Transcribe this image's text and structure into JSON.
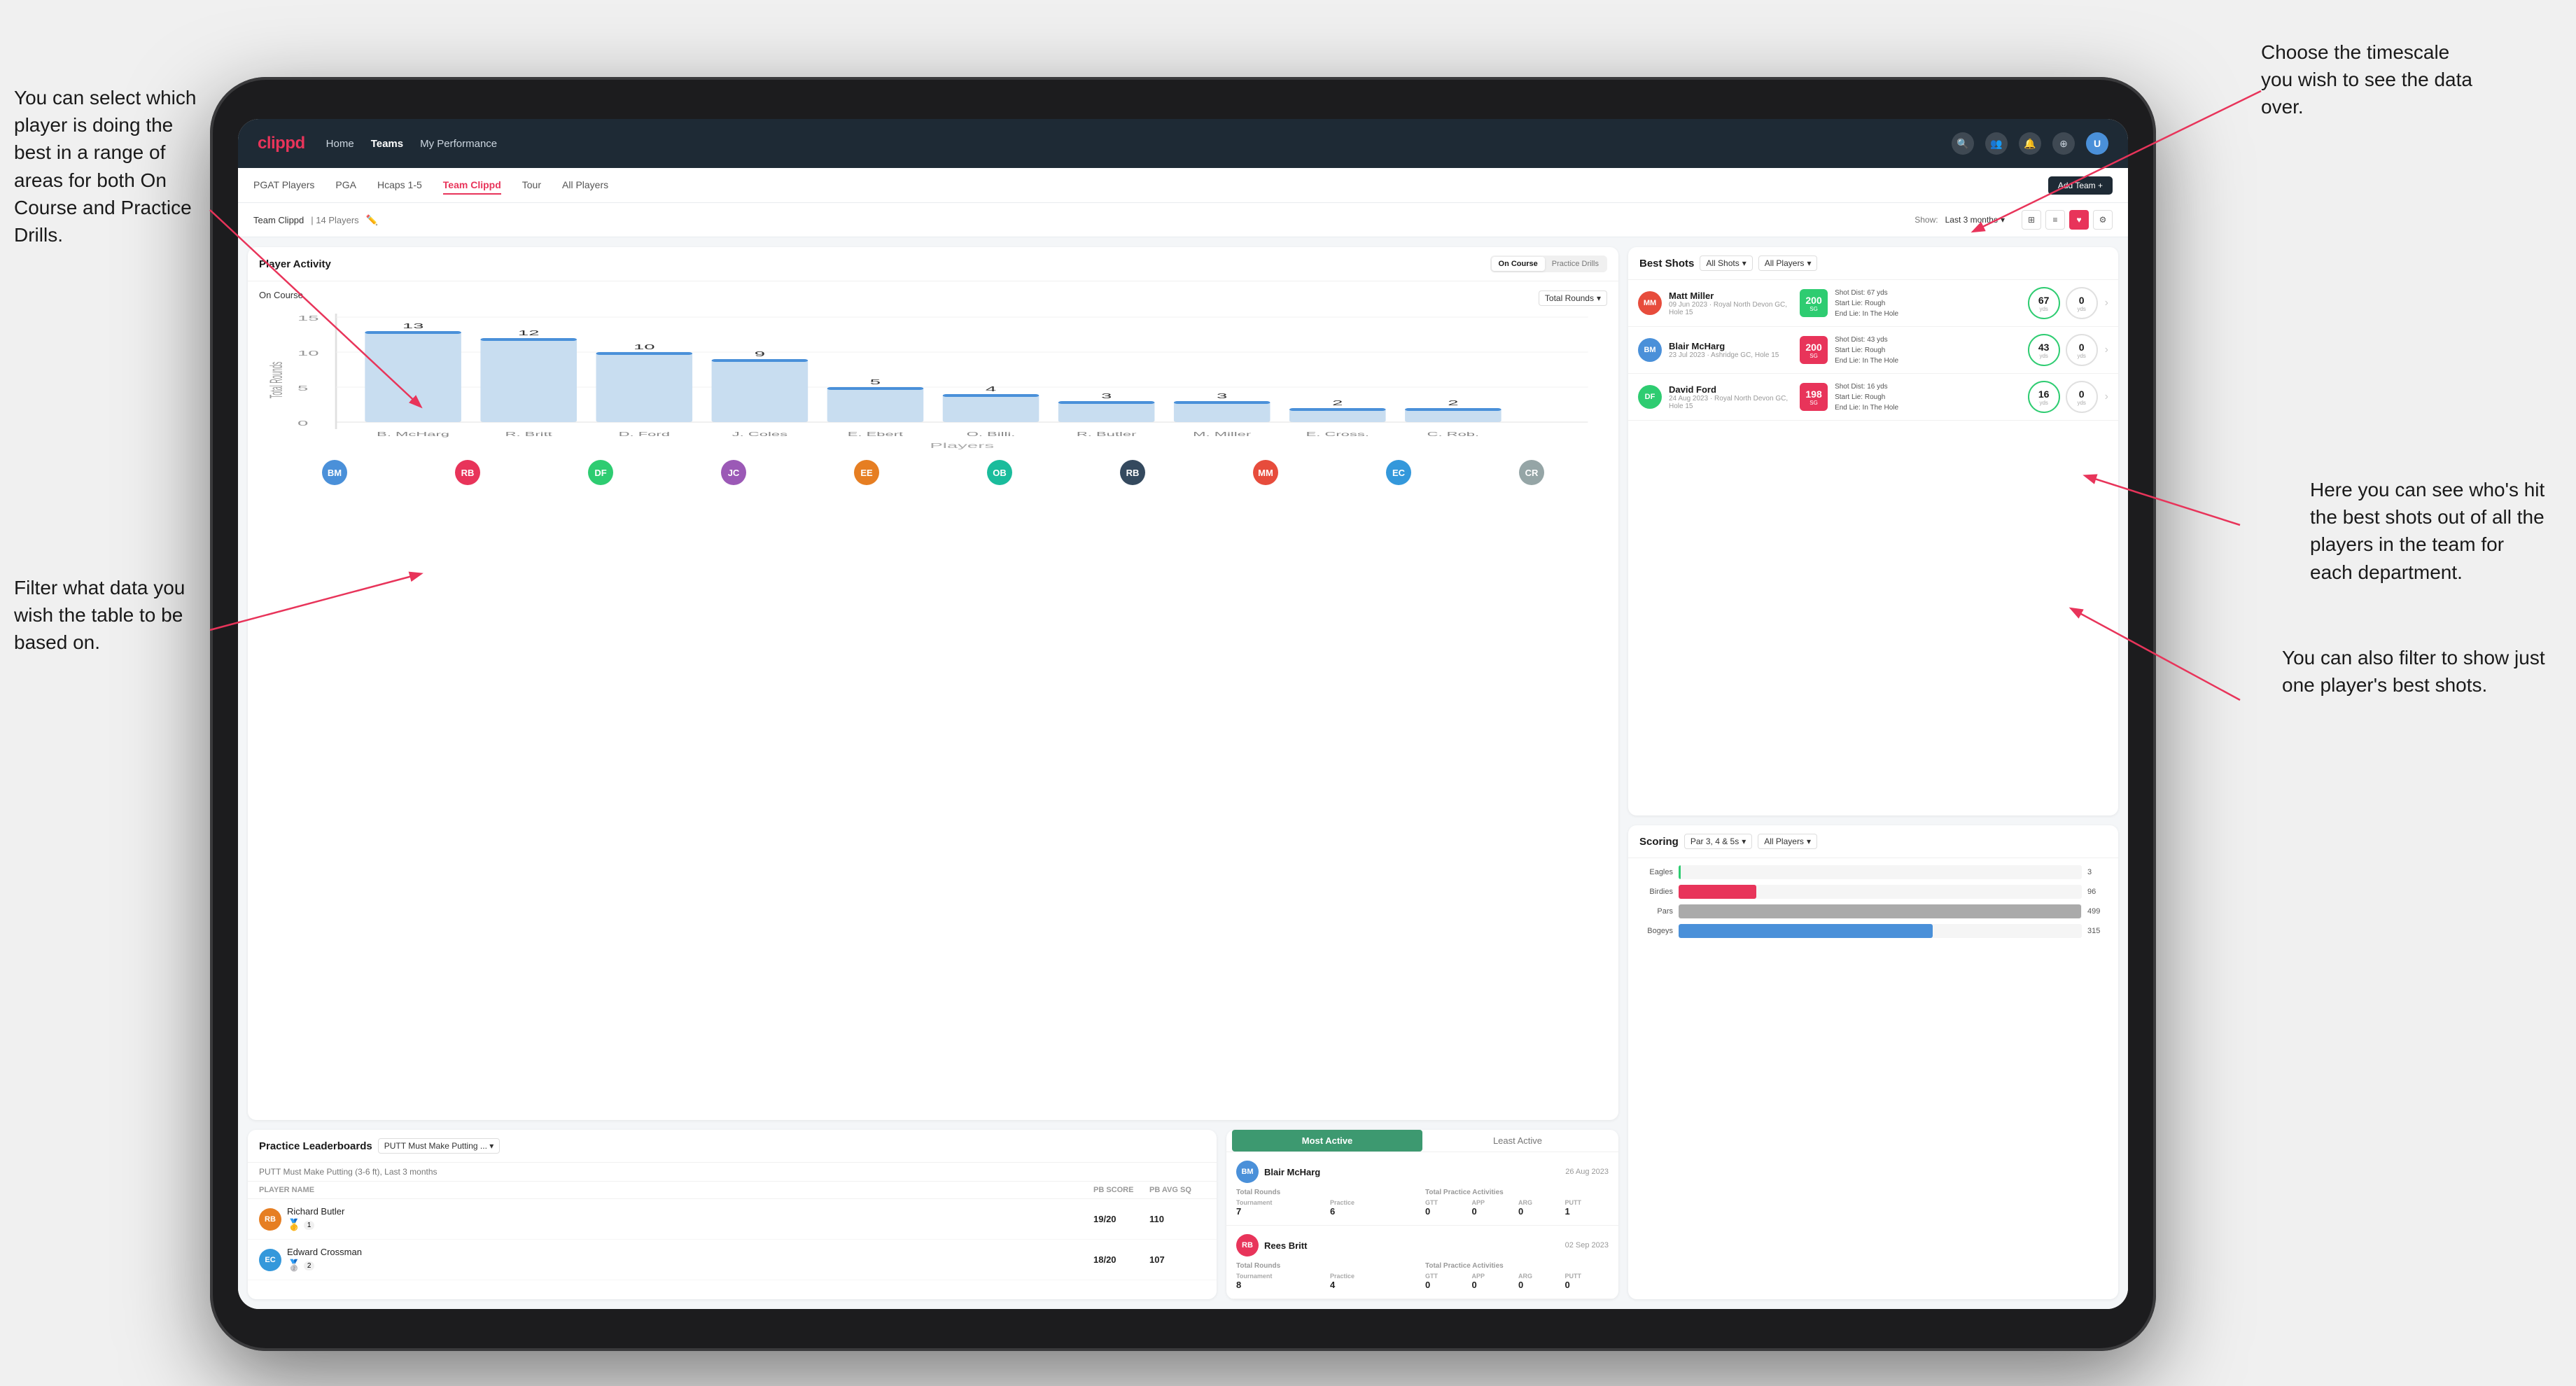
{
  "annotations": {
    "top_right": "Choose the timescale you wish to see the data over.",
    "left_top": "You can select which player is doing the best in a range of areas for both On Course and Practice Drills.",
    "left_bottom": "Filter what data you wish the table to be based on.",
    "right_middle": "Here you can see who's hit the best shots out of all the players in the team for each department.",
    "right_bottom": "You can also filter to show just one player's best shots."
  },
  "nav": {
    "logo": "clippd",
    "links": [
      "Home",
      "Teams",
      "My Performance"
    ],
    "active_link": "Teams"
  },
  "sub_tabs": [
    "PGAT Players",
    "PGA",
    "Hcaps 1-5",
    "Team Clippd",
    "Tour",
    "All Players"
  ],
  "active_tab": "Team Clippd",
  "add_team_btn": "Add Team +",
  "team_header": {
    "name": "Team Clippd",
    "count": "14 Players",
    "show_label": "Show:",
    "show_value": "Last 3 months",
    "view_options": [
      "grid",
      "table",
      "heart",
      "settings"
    ]
  },
  "player_activity": {
    "title": "Player Activity",
    "tabs": [
      "On Course",
      "Practice Drills"
    ],
    "active_tab": "On Course",
    "section": "On Course",
    "metric": "Total Rounds",
    "chart": {
      "y_label": "Total Rounds",
      "bars": [
        {
          "player": "B. McHarg",
          "value": 13,
          "color": "#4a90d9"
        },
        {
          "player": "R. Britt",
          "value": 12,
          "color": "#4a90d9"
        },
        {
          "player": "D. Ford",
          "value": 10,
          "color": "#4a90d9"
        },
        {
          "player": "J. Coles",
          "value": 9,
          "color": "#4a90d9"
        },
        {
          "player": "E. Ebert",
          "value": 5,
          "color": "#4a90d9"
        },
        {
          "player": "O. Billingham",
          "value": 4,
          "color": "#4a90d9"
        },
        {
          "player": "R. Butler",
          "value": 3,
          "color": "#4a90d9"
        },
        {
          "player": "M. Miller",
          "value": 3,
          "color": "#4a90d9"
        },
        {
          "player": "E. Crossman",
          "value": 2,
          "color": "#4a90d9"
        },
        {
          "player": "C. Robertson",
          "value": 2,
          "color": "#4a90d9"
        }
      ],
      "x_label": "Players",
      "y_max": 15
    }
  },
  "practice_leaderboards": {
    "title": "Practice Leaderboards",
    "drill": "PUTT Must Make Putting ...",
    "subtitle": "PUTT Must Make Putting (3-6 ft), Last 3 months",
    "columns": [
      "PLAYER NAME",
      "PB SCORE",
      "PB AVG SQ"
    ],
    "rows": [
      {
        "name": "Richard Butler",
        "rank_emoji": "🥇",
        "rank_num": "1",
        "pb_score": "19/20",
        "pb_avg": "110"
      },
      {
        "name": "Edward Crossman",
        "rank_emoji": "🥈",
        "rank_num": "2",
        "pb_score": "18/20",
        "pb_avg": "107"
      }
    ]
  },
  "most_active": {
    "tabs": [
      "Most Active",
      "Least Active"
    ],
    "active_tab": "Most Active",
    "players": [
      {
        "name": "Blair McHarg",
        "date": "26 Aug 2023",
        "total_rounds_label": "Total Rounds",
        "tournament": "7",
        "practice": "6",
        "total_practice_label": "Total Practice Activities",
        "gtt": "0",
        "app": "0",
        "arg": "0",
        "putt": "1"
      },
      {
        "name": "Rees Britt",
        "date": "02 Sep 2023",
        "total_rounds_label": "Total Rounds",
        "tournament": "8",
        "practice": "4",
        "total_practice_label": "Total Practice Activities",
        "gtt": "0",
        "app": "0",
        "arg": "0",
        "putt": "0"
      }
    ]
  },
  "best_shots": {
    "title": "Best Shots",
    "filter1": "All Shots",
    "filter2": "All Players",
    "shots": [
      {
        "player": "Matt Miller",
        "meta": "09 Jun 2023 · Royal North Devon GC, Hole 15",
        "badge_value": "200",
        "badge_sub": "SG",
        "badge_color": "green",
        "detail_dist": "Shot Dist: 67 yds",
        "detail_start": "Start Lie: Rough",
        "detail_end": "End Lie: In The Hole",
        "metric1_value": "67",
        "metric1_unit": "yds",
        "metric2_value": "0",
        "metric2_unit": "yds"
      },
      {
        "player": "Blair McHarg",
        "meta": "23 Jul 2023 · Ashridge GC, Hole 15",
        "badge_value": "200",
        "badge_sub": "SG",
        "badge_color": "pink",
        "detail_dist": "Shot Dist: 43 yds",
        "detail_start": "Start Lie: Rough",
        "detail_end": "End Lie: In The Hole",
        "metric1_value": "43",
        "metric1_unit": "yds",
        "metric2_value": "0",
        "metric2_unit": "yds"
      },
      {
        "player": "David Ford",
        "meta": "24 Aug 2023 · Royal North Devon GC, Hole 15",
        "badge_value": "198",
        "badge_sub": "SG",
        "badge_color": "pink",
        "detail_dist": "Shot Dist: 16 yds",
        "detail_start": "Start Lie: Rough",
        "detail_end": "End Lie: In The Hole",
        "metric1_value": "16",
        "metric1_unit": "yds",
        "metric2_value": "0",
        "metric2_unit": "yds"
      }
    ]
  },
  "scoring": {
    "title": "Scoring",
    "filter1": "Par 3, 4 & 5s",
    "filter2": "All Players",
    "bars": [
      {
        "label": "Eagles",
        "value": 3,
        "max": 500,
        "color": "#2ecc71"
      },
      {
        "label": "Birdies",
        "value": 96,
        "max": 500,
        "color": "#e8345a"
      },
      {
        "label": "Pars",
        "value": 499,
        "max": 500,
        "color": "#aaa"
      },
      {
        "label": "Bogeys",
        "value": 315,
        "max": 500,
        "color": "#4a90d9"
      }
    ]
  },
  "colors": {
    "brand_red": "#e8345a",
    "brand_dark": "#1e2a35",
    "green": "#2ecc71",
    "blue": "#4a90d9",
    "light_bg": "#f4f6f8"
  }
}
